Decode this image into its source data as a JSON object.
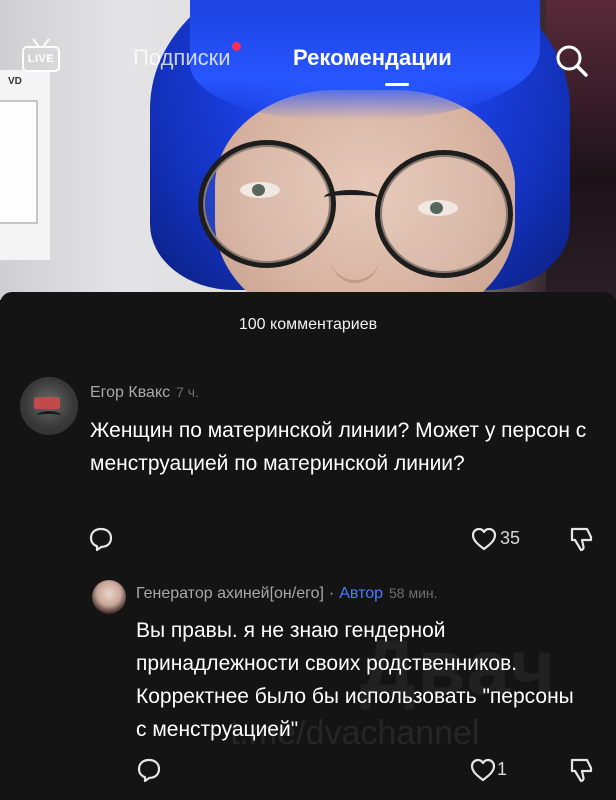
{
  "topbar": {
    "live_label": "LIVE",
    "tab_following": "Подписки",
    "tab_for_you": "Рекомендации"
  },
  "panel": {
    "comment_count": "100 комментариев"
  },
  "comments": [
    {
      "author": "Егор Квакс",
      "time": "7 ч.",
      "text": "Женщин по материнской линии? Может у персон с менструацией по материнской линии?",
      "likes": "35"
    },
    {
      "author": "Генератор ахиней[он/его]",
      "separator": "·",
      "badge": "Автор",
      "time": "58 мин.",
      "text": "Вы правы. я не знаю гендерной принадлежности своих родственников. Корректнее было бы использовать \"персоны с менструацией\"",
      "likes": "1"
    }
  ],
  "watermark": {
    "line1": "Двач",
    "line2": "t.me/dvachannel"
  },
  "colors": {
    "accent_author": "#4b7cff",
    "notification_dot": "#ff2c55",
    "panel_bg": "#141414"
  },
  "icons": [
    "live-icon",
    "search-icon",
    "reply-icon",
    "heart-icon",
    "dislike-icon"
  ]
}
